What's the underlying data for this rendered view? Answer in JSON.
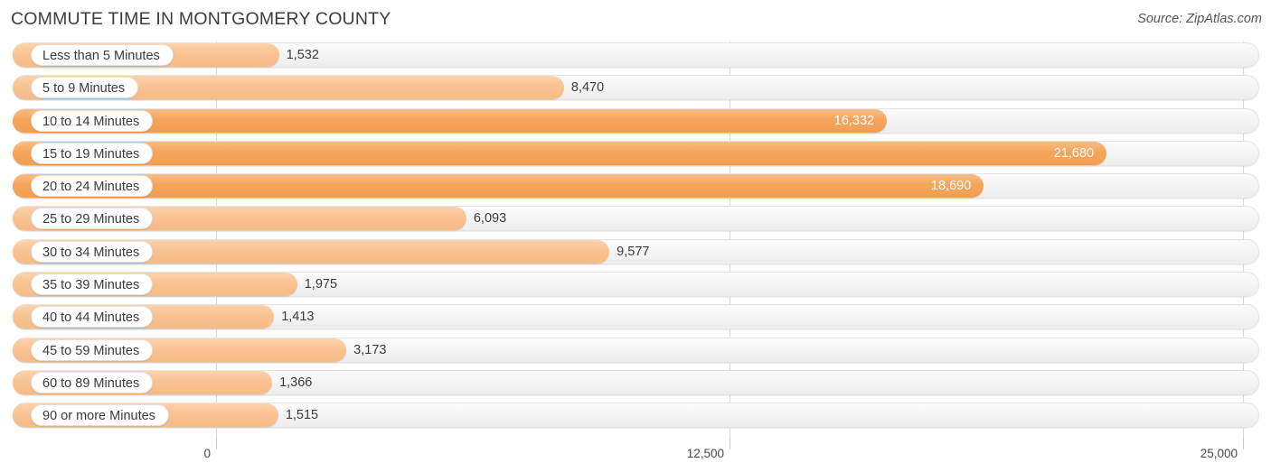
{
  "header": {
    "title": "COMMUTE TIME IN MONTGOMERY COUNTY",
    "source": "Source: ZipAtlas.com"
  },
  "chart_data": {
    "type": "bar",
    "orientation": "horizontal",
    "title": "COMMUTE TIME IN MONTGOMERY COUNTY",
    "xlabel": "",
    "ylabel": "",
    "xlim": [
      0,
      25000
    ],
    "grid": true,
    "legend": null,
    "axis_ticks": [
      "0",
      "12,500",
      "25,000"
    ],
    "axis_tick_values": [
      0,
      12500,
      25000
    ],
    "categories": [
      "Less than 5 Minutes",
      "5 to 9 Minutes",
      "10 to 14 Minutes",
      "15 to 19 Minutes",
      "20 to 24 Minutes",
      "25 to 29 Minutes",
      "30 to 34 Minutes",
      "35 to 39 Minutes",
      "40 to 44 Minutes",
      "45 to 59 Minutes",
      "60 to 89 Minutes",
      "90 or more Minutes"
    ],
    "values": [
      1532,
      8470,
      16332,
      21680,
      18690,
      6093,
      9577,
      1975,
      1413,
      3173,
      1366,
      1515
    ],
    "value_labels": [
      "1,532",
      "8,470",
      "16,332",
      "21,680",
      "18,690",
      "6,093",
      "9,577",
      "1,975",
      "1,413",
      "3,173",
      "1,366",
      "1,515"
    ],
    "label_inside": [
      false,
      false,
      true,
      true,
      true,
      false,
      false,
      false,
      false,
      false,
      false,
      false
    ],
    "bar_shade": [
      "light",
      "light",
      "dark",
      "dark",
      "dark",
      "light",
      "light",
      "light",
      "light",
      "light",
      "light",
      "light"
    ],
    "colors": {
      "bar_light": "#f9c392",
      "bar_dark": "#f5a45a",
      "track": "#f4f4f4",
      "gridline": "#d8d8d8",
      "value_text_outside": "#3b3b3b",
      "value_text_inside": "#ffffff",
      "title_text": "#3d3d3d"
    }
  }
}
